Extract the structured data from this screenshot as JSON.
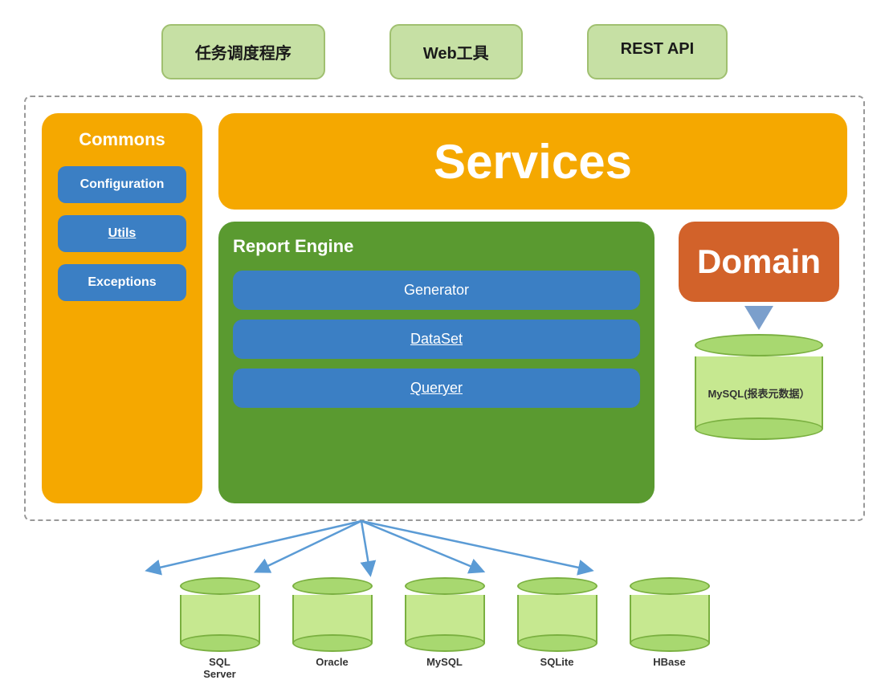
{
  "topBoxes": [
    {
      "id": "task-scheduler",
      "label": "任务调度程序"
    },
    {
      "id": "web-tools",
      "label": "Web工具"
    },
    {
      "id": "rest-api",
      "label": "REST API"
    }
  ],
  "commons": {
    "title": "Commons",
    "items": [
      {
        "id": "configuration",
        "label": "Configuration"
      },
      {
        "id": "utils",
        "label": "Utils"
      },
      {
        "id": "exceptions",
        "label": "Exceptions"
      }
    ]
  },
  "services": {
    "title": "Services"
  },
  "reportEngine": {
    "title": "Report Engine",
    "items": [
      {
        "id": "generator",
        "label": "Generator",
        "underline": false
      },
      {
        "id": "dataset",
        "label": "DataSet",
        "underline": true
      },
      {
        "id": "queryer",
        "label": "Queryer",
        "underline": true
      }
    ]
  },
  "domain": {
    "title": "Domain"
  },
  "mysqlLabel": "MySQL(报表元数据）",
  "bottomDatabases": [
    {
      "id": "sql-server",
      "label": "SQL\nServer"
    },
    {
      "id": "oracle",
      "label": "Oracle"
    },
    {
      "id": "mysql",
      "label": "MySQL"
    },
    {
      "id": "sqlite",
      "label": "SQLite"
    },
    {
      "id": "hbase",
      "label": "HBase"
    }
  ]
}
